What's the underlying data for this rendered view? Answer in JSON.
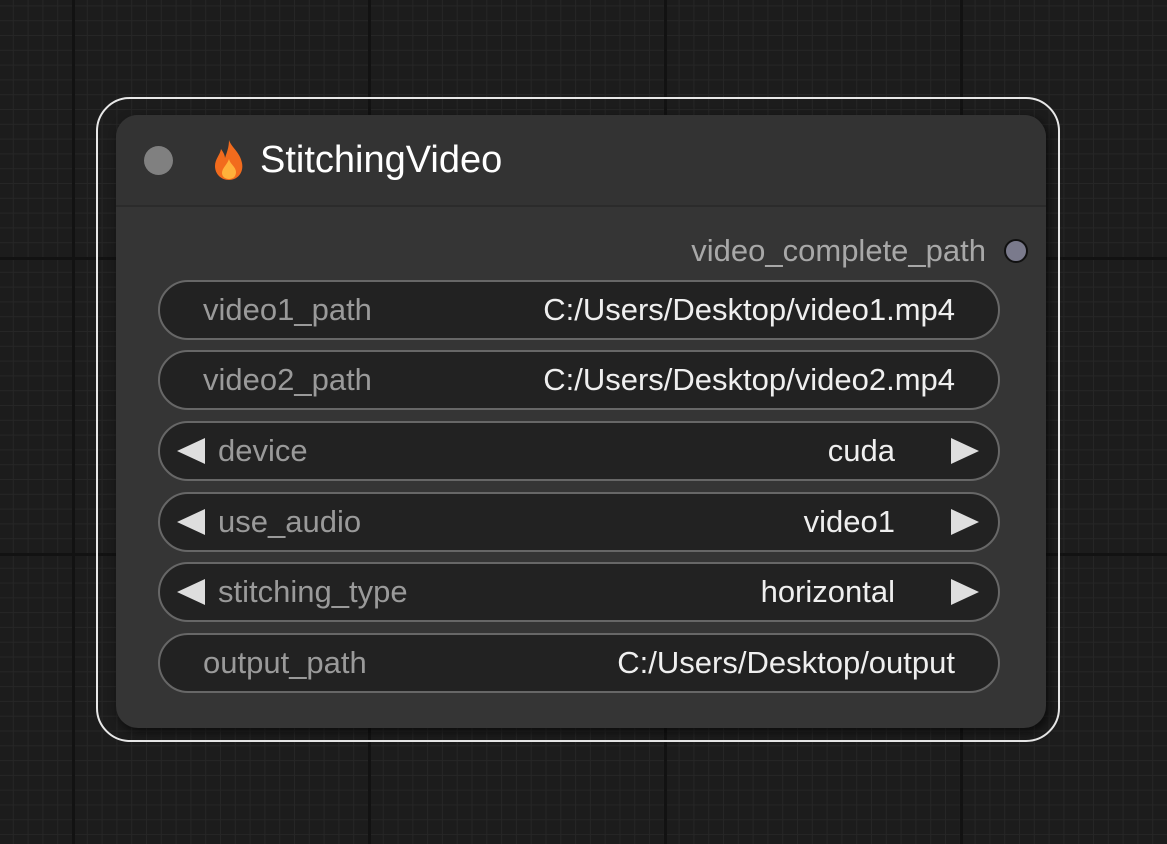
{
  "node": {
    "title": "StitchingVideo",
    "title_icon": "fire-icon",
    "collapse_icon": "collapse-dot-icon",
    "output": {
      "label": "video_complete_path",
      "slot_color": "#7a7a8c"
    },
    "widgets": [
      {
        "type": "text",
        "label": "video1_path",
        "value": "C:/Users/Desktop/video1.mp4"
      },
      {
        "type": "text",
        "label": "video2_path",
        "value": "C:/Users/Desktop/video2.mp4"
      },
      {
        "type": "combo",
        "label": "device",
        "value": "cuda"
      },
      {
        "type": "combo",
        "label": "use_audio",
        "value": "video1"
      },
      {
        "type": "combo",
        "label": "stitching_type",
        "value": "horizontal"
      },
      {
        "type": "text",
        "label": "output_path",
        "value": "C:/Users/Desktop/output"
      }
    ]
  },
  "colors": {
    "canvas_background": "#1c1c1c",
    "node_body": "#353535",
    "widget_background": "#222222",
    "selection_outline": "#e8e8e8",
    "fire_outer": "#f26b1d",
    "fire_inner": "#ffb13b"
  }
}
